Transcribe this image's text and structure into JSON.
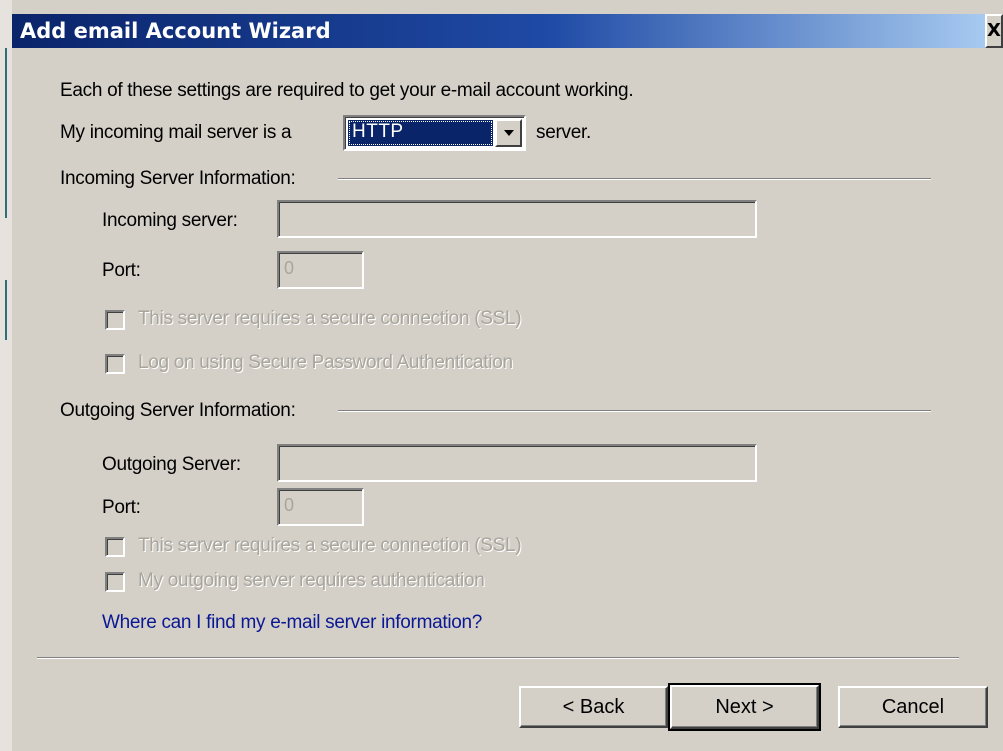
{
  "window": {
    "title": "Add email Account Wizard",
    "close_label": "X"
  },
  "intro": {
    "text": "Each of these settings are required to get your e-mail account working."
  },
  "server_type": {
    "label_before": "My incoming mail server is a",
    "selected_value": "HTTP",
    "label_after": "server."
  },
  "incoming": {
    "section_label": "Incoming Server Information:",
    "server_label": "Incoming server:",
    "server_value": "",
    "port_label": "Port:",
    "port_value": "0",
    "ssl_label": "This server requires a secure connection (SSL)",
    "ssl_checked": false,
    "spa_label": "Log on using Secure Password Authentication",
    "spa_checked": false
  },
  "outgoing": {
    "section_label": "Outgoing Server Information:",
    "server_label": "Outgoing Server:",
    "server_value": "",
    "port_label": "Port:",
    "port_value": "0",
    "ssl_label": "This server requires a secure connection (SSL)",
    "ssl_checked": false,
    "auth_label": "My outgoing server requires authentication",
    "auth_checked": false
  },
  "help_link": {
    "text": "Where can I find my e-mail server information?"
  },
  "buttons": {
    "back": "< Back",
    "next": "Next >",
    "cancel": "Cancel"
  },
  "colors": {
    "dialog_face": "#d4d0c8",
    "titlebar_start": "#0a246a",
    "titlebar_end": "#a6caf0",
    "link": "#0b1893",
    "disabled_text": "#a8a59d",
    "selection": "#0a246a"
  }
}
